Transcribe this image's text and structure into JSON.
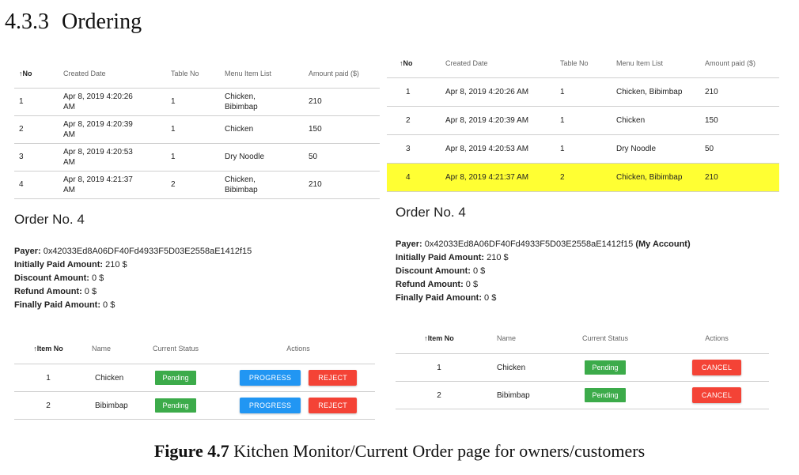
{
  "section": {
    "number": "4.3.3",
    "title": "Ordering"
  },
  "sort_arrow": "↑",
  "left": {
    "columns": [
      "No",
      "Created Date",
      "Table No",
      "Menu Item List",
      "Amount paid ($)"
    ],
    "rows": [
      {
        "no": "1",
        "date_1": "Apr 8, 2019 4:20:26",
        "date_2": "AM",
        "table": "1",
        "menu_1": "Chicken,",
        "menu_2": "Bibimbap",
        "amount": "210"
      },
      {
        "no": "2",
        "date_1": "Apr 8, 2019 4:20:39",
        "date_2": "AM",
        "table": "1",
        "menu_1": "Chicken",
        "menu_2": "",
        "amount": "150"
      },
      {
        "no": "3",
        "date_1": "Apr 8, 2019 4:20:53",
        "date_2": "AM",
        "table": "1",
        "menu_1": "Dry Noodle",
        "menu_2": "",
        "amount": "50"
      },
      {
        "no": "4",
        "date_1": "Apr 8, 2019 4:21:37",
        "date_2": "AM",
        "table": "2",
        "menu_1": "Chicken,",
        "menu_2": "Bibimbap",
        "amount": "210"
      }
    ],
    "order_title": "Order No. 4",
    "payer_label": "Payer:",
    "payer_value": " 0x42033Ed8A06DF40Fd4933F5D03E2558aE1412f15",
    "initial_label": "Initially Paid Amount:",
    "initial_value": " 210 $",
    "discount_label": "Discount Amount:",
    "discount_value": " 0 $",
    "refund_label": "Refund Amount:",
    "refund_value": " 0 $",
    "final_label": "Finally Paid Amount:",
    "final_value": " 0 $",
    "item_columns": [
      "Item No",
      "Name",
      "Current Status",
      "Actions"
    ],
    "items": [
      {
        "no": "1",
        "name": "Chicken",
        "status": "Pending",
        "action_1": "PROGRESS",
        "action_2": "REJECT"
      },
      {
        "no": "2",
        "name": "Bibimbap",
        "status": "Pending",
        "action_1": "PROGRESS",
        "action_2": "REJECT"
      }
    ]
  },
  "right": {
    "columns": [
      "No",
      "Created Date",
      "Table No",
      "Menu Item List",
      "Amount paid ($)"
    ],
    "rows": [
      {
        "no": "1",
        "date": "Apr 8, 2019 4:20:26 AM",
        "table": "1",
        "menu": "Chicken, Bibimbap",
        "amount": "210"
      },
      {
        "no": "2",
        "date": "Apr 8, 2019 4:20:39 AM",
        "table": "1",
        "menu": "Chicken",
        "amount": "150"
      },
      {
        "no": "3",
        "date": "Apr 8, 2019 4:20:53 AM",
        "table": "1",
        "menu": "Dry Noodle",
        "amount": "50"
      },
      {
        "no": "4",
        "date": "Apr 8, 2019 4:21:37 AM",
        "table": "2",
        "menu": "Chicken, Bibimbap",
        "amount": "210"
      }
    ],
    "highlight_color": "#ffff33",
    "order_title": "Order No. 4",
    "payer_label": "Payer:",
    "payer_value": " 0x42033Ed8A06DF40Fd4933F5D03E2558aE1412f15 ",
    "payer_note": "(My Account)",
    "initial_label": "Initially Paid Amount:",
    "initial_value": " 210 $",
    "discount_label": "Discount Amount:",
    "discount_value": " 0 $",
    "refund_label": "Refund Amount:",
    "refund_value": " 0 $",
    "final_label": "Finally Paid Amount:",
    "final_value": " 0 $",
    "item_columns": [
      "Item No",
      "Name",
      "Current Status",
      "Actions"
    ],
    "items": [
      {
        "no": "1",
        "name": "Chicken",
        "status": "Pending",
        "action": "CANCEL"
      },
      {
        "no": "2",
        "name": "Bibimbap",
        "status": "Pending",
        "action": "CANCEL"
      }
    ]
  },
  "colors": {
    "pending_badge": "#3cab4a",
    "progress_button": "#2196f3",
    "reject_button": "#f44336",
    "cancel_button": "#f44336"
  },
  "caption": {
    "label": "Figure 4.7",
    "text": " Kitchen Monitor/Current Order page for owners/customers"
  }
}
